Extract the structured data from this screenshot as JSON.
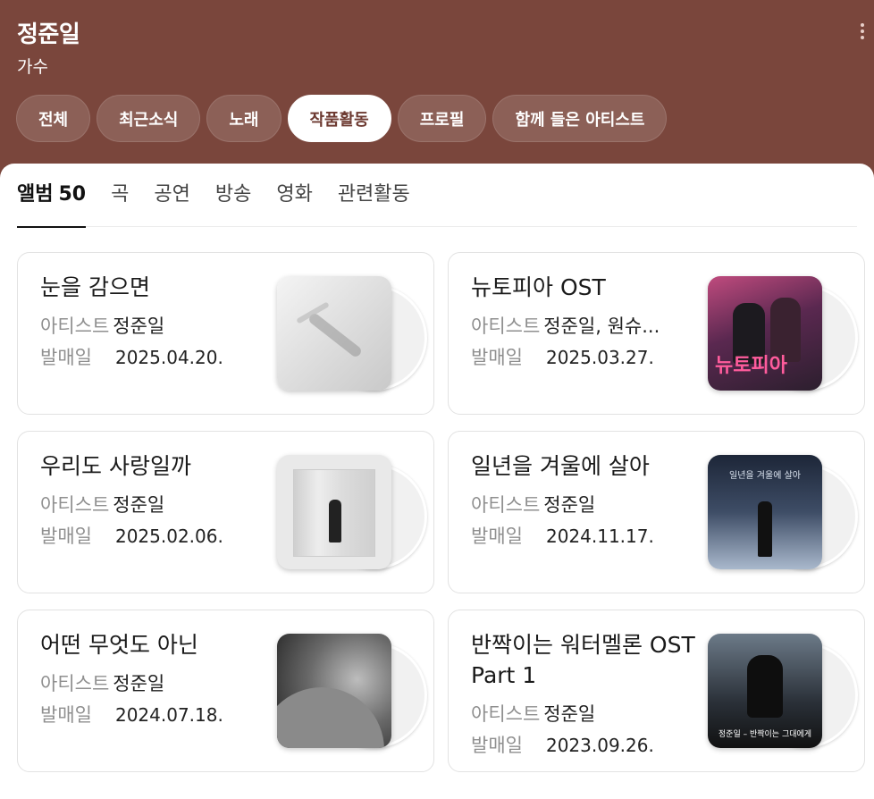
{
  "header": {
    "title": "정준일",
    "subtitle": "가수",
    "colors": {
      "background": "#7a463c",
      "active_chip_text": "#6d3a31"
    },
    "more_icon": "more-vertical-icon"
  },
  "chips": [
    {
      "label": "전체"
    },
    {
      "label": "최근소식"
    },
    {
      "label": "노래"
    },
    {
      "label": "작품활동",
      "active": true
    },
    {
      "label": "프로필"
    },
    {
      "label": "함께 들은 아티스트"
    }
  ],
  "subtabs": [
    {
      "label": "앨범",
      "count": "50",
      "active": true
    },
    {
      "label": "곡"
    },
    {
      "label": "공연"
    },
    {
      "label": "방송"
    },
    {
      "label": "영화"
    },
    {
      "label": "관련활동"
    }
  ],
  "labels": {
    "artist": "아티스트",
    "release": "발매일"
  },
  "albums": [
    {
      "title": "눈을 감으면",
      "artist": "정준일",
      "date": "2025.04.20."
    },
    {
      "title": "뉴토피아 OST",
      "artist": "정준일, 원슈...",
      "date": "2025.03.27.",
      "cover_text": "뉴토피아"
    },
    {
      "title": "우리도 사랑일까",
      "artist": "정준일",
      "date": "2025.02.06."
    },
    {
      "title": "일년을 겨울에 살아",
      "artist": "정준일",
      "date": "2024.11.17.",
      "cover_text": "일년을 겨울에 살아"
    },
    {
      "title": "어떤 무엇도 아닌",
      "artist": "정준일",
      "date": "2024.07.18."
    },
    {
      "title": "반짝이는 워터멜론 OST Part 1",
      "artist": "정준일",
      "date": "2023.09.26.",
      "cover_text": "정준일 – 반짝이는 그대에게"
    }
  ]
}
